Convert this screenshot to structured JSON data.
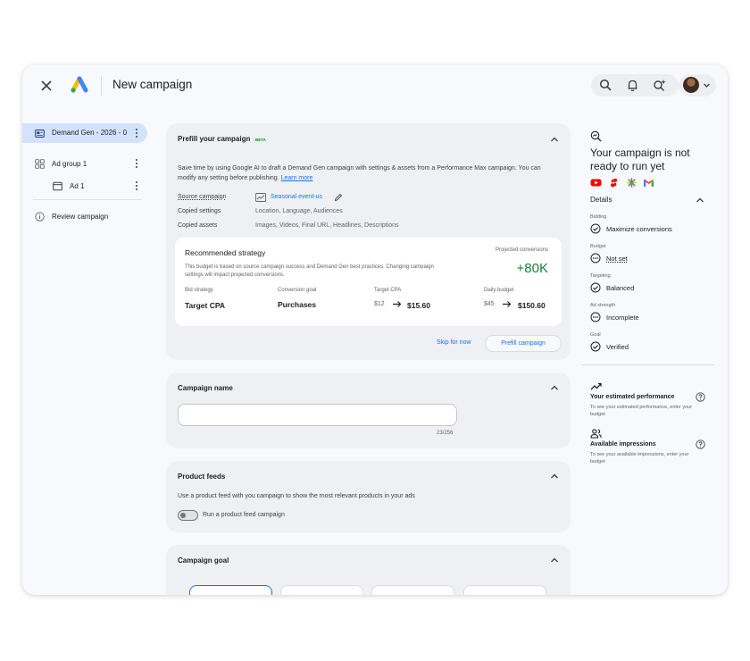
{
  "header": {
    "title": "New campaign"
  },
  "nav": {
    "campaign": "Demand Gen - 2026 - 0",
    "ad_group": "Ad group 1",
    "ad": "Ad 1",
    "review": "Review campaign"
  },
  "prefill": {
    "title": "Prefill your campaign",
    "badge": "BETA",
    "description": "Save time by using Google AI to draft a Demand Gen campaign with settings & assets from a Performance Max campaign. You can modify any setting before publishing.",
    "learn_more": "Learn more",
    "source_label": "Source campaign",
    "source_value": "Seasonal event-us",
    "copied_settings_label": "Copied settings",
    "copied_settings_value": "Location, Language, Audiences",
    "copied_assets_label": "Copied assets",
    "copied_assets_value": "Images, Videos, Final URL, Headlines, Descriptions",
    "strategy": {
      "title": "Recommended strategy",
      "description": "This budget is based on source campaign success and Demand Gen best practices. Changing campaign settings will impact projected conversions.",
      "projected_label": "Projected conversions",
      "projected_value": "+80K",
      "bid_label": "Bid strategy",
      "bid_value": "Target CPA",
      "goal_label": "Conversion goal",
      "goal_value": "Purchases",
      "cpa_label": "Target CPA",
      "cpa_old": "$12",
      "cpa_new": "$15.60",
      "budget_label": "Daily budget",
      "budget_old": "$45",
      "budget_new": "$150.60"
    },
    "skip": "Skip for now",
    "prefill_button": "Prefill campaign"
  },
  "campaign_name": {
    "title": "Campaign name",
    "value": "",
    "counter": "23/256"
  },
  "product_feeds": {
    "title": "Product feeds",
    "description": "Use a product feed with you campaign to show the most relevant products in your ads",
    "toggle_label": "Run a product feed campaign",
    "toggle_on": false
  },
  "campaign_goal": {
    "title": "Campaign goal"
  },
  "status_panel": {
    "title": "Your campaign is not ready to run yet",
    "details_label": "Details",
    "brands": [
      "youtube-icon",
      "shorts-icon",
      "discover-icon",
      "gmail-icon"
    ],
    "items": [
      {
        "label": "Bidding",
        "value": "Maximize conversions",
        "status": "complete"
      },
      {
        "label": "Budget",
        "value": "Not set",
        "status": "incomplete"
      },
      {
        "label": "Targeting",
        "value": "Balanced",
        "status": "complete"
      },
      {
        "label": "Ad strength",
        "value": "Incomplete",
        "status": "incomplete"
      },
      {
        "label": "Goal",
        "value": "Verified",
        "status": "complete"
      }
    ],
    "performance_title": "Your estimated performance",
    "performance_desc": "To see your estimated performance, enter your budget",
    "impressions_title": "Available impressions",
    "impressions_desc": "To see your available impressions, enter your budget"
  },
  "colors": {
    "accent": "#1a73e8",
    "success": "#188038",
    "nav_active": "#d3e3fd"
  }
}
